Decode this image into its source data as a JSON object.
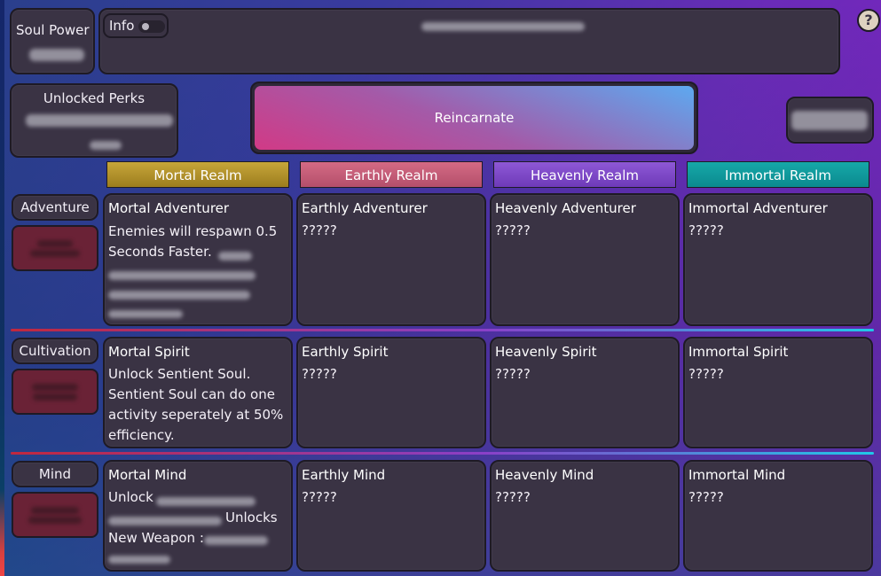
{
  "header": {
    "soul_power_label": "Soul Power",
    "info_label": "Info",
    "help_symbol": "?",
    "unlocked_perks_label": "Unlocked Perks",
    "reincarnate_label": "Reincarnate"
  },
  "realms": [
    "Mortal Realm",
    "Earthly Realm",
    "Heavenly Realm",
    "Immortal Realm"
  ],
  "rows": [
    {
      "label": "Adventure",
      "cards": [
        {
          "title": "Mortal Adventurer",
          "line1": "Enemies will respawn 0.5",
          "line2": "Seconds Faster."
        },
        {
          "title": "Earthly Adventurer",
          "line1": "?????"
        },
        {
          "title": "Heavenly Adventurer",
          "line1": "?????"
        },
        {
          "title": "Immortal Adventurer",
          "line1": "?????"
        }
      ]
    },
    {
      "label": "Cultivation",
      "cards": [
        {
          "title": "Mortal Spirit",
          "text": "Unlock Sentient Soul. Sentient Soul can do one activity seperately at 50% efficiency."
        },
        {
          "title": "Earthly Spirit",
          "line1": "?????"
        },
        {
          "title": "Heavenly Spirit",
          "line1": "?????"
        },
        {
          "title": "Immortal Spirit",
          "line1": "?????"
        }
      ]
    },
    {
      "label": "Mind",
      "cards": [
        {
          "title": "Mortal Mind",
          "line1": "Unlock",
          "line2": "Unlocks",
          "line3": "New Weapon :"
        },
        {
          "title": "Earthly Mind",
          "line1": "?????"
        },
        {
          "title": "Heavenly Mind",
          "line1": "?????"
        },
        {
          "title": "Immortal Mind",
          "line1": "?????"
        }
      ]
    }
  ],
  "colors": {
    "panel": "#3a3344",
    "mortal": "#b8962d",
    "earthly": "#c45c78",
    "heavenly": "#7e4ac8",
    "immortal": "#119a9d",
    "row_button": "#6a2236"
  },
  "icons": {
    "help": "question-mark-icon"
  }
}
